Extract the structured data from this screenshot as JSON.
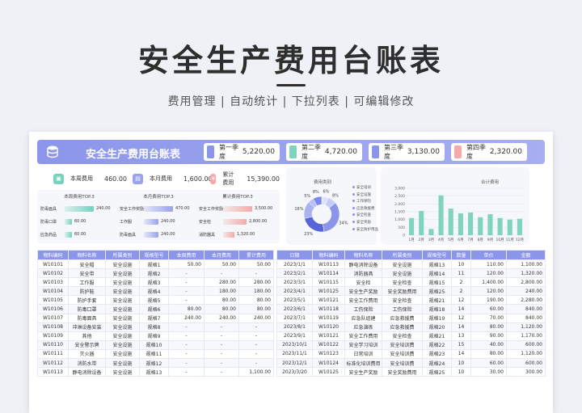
{
  "hero": {
    "title": "安全生产费用台账表",
    "subtitle": "费用管理 | 自动统计 | 下拉列表 | 可编辑修改"
  },
  "banner": {
    "title": "安全生产费用台账表",
    "quarters": [
      {
        "label": "第一季度",
        "value": "5,220.00",
        "color": "#8b96ea"
      },
      {
        "label": "第二季度",
        "value": "4,720.00",
        "color": "#7fd3bf"
      },
      {
        "label": "第三季度",
        "value": "3,130.00",
        "color": "#8b96ea"
      },
      {
        "label": "第四季度",
        "value": "2,320.00",
        "color": "#f3aaa8"
      }
    ]
  },
  "stats": [
    {
      "label": "本周费用",
      "value": "460.00",
      "color": "#74d2bd",
      "icon": "wallet-icon"
    },
    {
      "label": "本月费用",
      "value": "1,600.00",
      "color": "#9aa2ee",
      "icon": "document-icon"
    },
    {
      "label": "累计费用",
      "value": "15,390.00",
      "color": "#f3aaa8",
      "icon": "money-bag-icon"
    }
  ],
  "top3": [
    {
      "title": "本周费用TOP.3",
      "color": "#74d2bd",
      "items": [
        {
          "label": "防毒面具",
          "value": "240.00",
          "fraction": 1.0
        },
        {
          "label": "防毒口罩",
          "value": "60.00",
          "fraction": 0.25
        },
        {
          "label": "应急药品",
          "value": "60.00",
          "fraction": 0.25
        }
      ]
    },
    {
      "title": "本月费用TOP.3",
      "color": "#9aa2ee",
      "items": [
        {
          "label": "安全工作奖励",
          "value": "470.00",
          "fraction": 1.0
        },
        {
          "label": "工作服",
          "value": "240.00",
          "fraction": 0.51
        },
        {
          "label": "防毒面具",
          "value": "240.00",
          "fraction": 0.51
        }
      ]
    },
    {
      "title": "累计费用TOP.3",
      "color": "#f3aaa8",
      "items": [
        {
          "label": "安全工作奖励",
          "value": "3,500.00",
          "fraction": 1.0
        },
        {
          "label": "安全检",
          "value": "2,800.00",
          "fraction": 0.8
        },
        {
          "label": "消防器具",
          "value": "1,320.00",
          "fraction": 0.38
        }
      ]
    }
  ],
  "chart_data": [
    {
      "type": "pie",
      "title": "费用类别",
      "categories": [
        "安全培训",
        "安全设施",
        "工作保险",
        "应急救援费",
        "安全检查",
        "安全奖励",
        "安全防护用品"
      ],
      "values": [
        6,
        8,
        34,
        23,
        16,
        5,
        8
      ],
      "labels": [
        "6%",
        "8%",
        "34%",
        "23%",
        "16%",
        "5%",
        "8%"
      ],
      "colors": [
        "#dfe2fb",
        "#c7ccf6",
        "#8b96ea",
        "#5865d8",
        "#aab2f1",
        "#b8bef4",
        "#7c87e6"
      ]
    },
    {
      "type": "bar",
      "title": "合计费用",
      "categories": [
        "1月",
        "2月",
        "3月",
        "4月",
        "5月",
        "6月",
        "7月",
        "8月",
        "9月",
        "10月",
        "11月",
        "12月"
      ],
      "values": [
        1100,
        1550,
        400,
        2550,
        1700,
        1400,
        1450,
        1150,
        1350,
        1100,
        1000,
        1050
      ],
      "yticks": [
        "0",
        "500",
        "1,000",
        "1,500",
        "2,000",
        "2,500",
        "3,000"
      ],
      "ylim": [
        0,
        3000
      ]
    }
  ],
  "left_table": {
    "headers": [
      "物料编码",
      "物料名称",
      "所属类别",
      "规格型号",
      "本周费用",
      "本月费用",
      "累计费用"
    ],
    "rows": [
      [
        "W10101",
        "安全帽",
        "安全设施",
        "规格1",
        "50.00",
        "50.00",
        "50.00"
      ],
      [
        "W10102",
        "安全带",
        "安全设施",
        "规格2",
        "-",
        "-",
        "-"
      ],
      [
        "W10103",
        "工作服",
        "安全设施",
        "规格3",
        "-",
        "280.00",
        "280.00"
      ],
      [
        "W10104",
        "防护鞋",
        "安全设施",
        "规格4",
        "-",
        "180.00",
        "180.00"
      ],
      [
        "W10105",
        "防护手套",
        "安全设施",
        "规格5",
        "-",
        "80.00",
        "80.00"
      ],
      [
        "W10106",
        "防毒口罩",
        "安全设施",
        "规格6",
        "80.00",
        "80.00",
        "80.00"
      ],
      [
        "W10107",
        "防毒面具",
        "安全设施",
        "规格7",
        "240.00",
        "240.00",
        "240.00"
      ],
      [
        "W10108",
        "冲淋设备安装",
        "安全设施",
        "规格8",
        "-",
        "-",
        "-"
      ],
      [
        "W10109",
        "其他",
        "安全设施",
        "规格9",
        "-",
        "-",
        "-"
      ],
      [
        "W10110",
        "安全警示牌",
        "安全设施",
        "规格10",
        "-",
        "-",
        "-"
      ],
      [
        "W10111",
        "灭火器",
        "安全设施",
        "规格11",
        "-",
        "-",
        "-"
      ],
      [
        "W10112",
        "消防水带",
        "安全设施",
        "规格12",
        "-",
        "-",
        "-"
      ],
      [
        "W10113",
        "静电消除设备",
        "安全设施",
        "规格13",
        "-",
        "-",
        "1,100.00"
      ]
    ]
  },
  "right_table": {
    "headers": [
      "日期",
      "物料编码",
      "物料名称",
      "所属类别",
      "规格型号",
      "数量",
      "单价",
      "金额"
    ],
    "rows": [
      [
        "2023/1/1",
        "W10113",
        "静电消除设备",
        "安全设施",
        "规格13",
        "10",
        "110.00",
        "1,100.00"
      ],
      [
        "2023/2/1",
        "W10114",
        "消防器具",
        "安全设施",
        "规格14",
        "11",
        "120.00",
        "1,320.00"
      ],
      [
        "2023/3/1",
        "W10115",
        "安全检",
        "安全检查",
        "规格15",
        "2",
        "1,400.00",
        "2,800.00"
      ],
      [
        "2023/4/1",
        "W10125",
        "安全生产奖励",
        "安全奖励费用",
        "规格25",
        "2",
        "120.00",
        "240.00"
      ],
      [
        "2023/5/1",
        "W10121",
        "安全工作费用",
        "安全检查",
        "规格21",
        "12",
        "190.00",
        "2,280.00"
      ],
      [
        "2023/6/1",
        "W10118",
        "工伤保险",
        "工伤保险",
        "规格18",
        "14",
        "60.00",
        "840.00"
      ],
      [
        "2023/7/1",
        "W10119",
        "应急队组建",
        "应急救援费",
        "规格19",
        "12",
        "70.00",
        "840.00"
      ],
      [
        "2023/8/1",
        "W10120",
        "应急演练",
        "应急救援费",
        "规格20",
        "14",
        "80.00",
        "1,120.00"
      ],
      [
        "2023/9/1",
        "W10121",
        "安全工作费用",
        "安全检查",
        "规格21",
        "13",
        "90.00",
        "1,170.00"
      ],
      [
        "2023/10/1",
        "W10122",
        "安全学习培训",
        "安全培训费",
        "规格22",
        "15",
        "40.00",
        "600.00"
      ],
      [
        "2023/11/1",
        "W10123",
        "日常培训",
        "安全培训费",
        "规格23",
        "14",
        "80.00",
        "1,120.00"
      ],
      [
        "2023/12/1",
        "W10124",
        "标准化培训费用",
        "安全培训费",
        "规格24",
        "10",
        "60.00",
        "600.00"
      ],
      [
        "2023/3/20",
        "W10125",
        "安全生产奖励",
        "安全奖励费用",
        "规格25",
        "10",
        "30.00",
        "300.00"
      ]
    ]
  }
}
